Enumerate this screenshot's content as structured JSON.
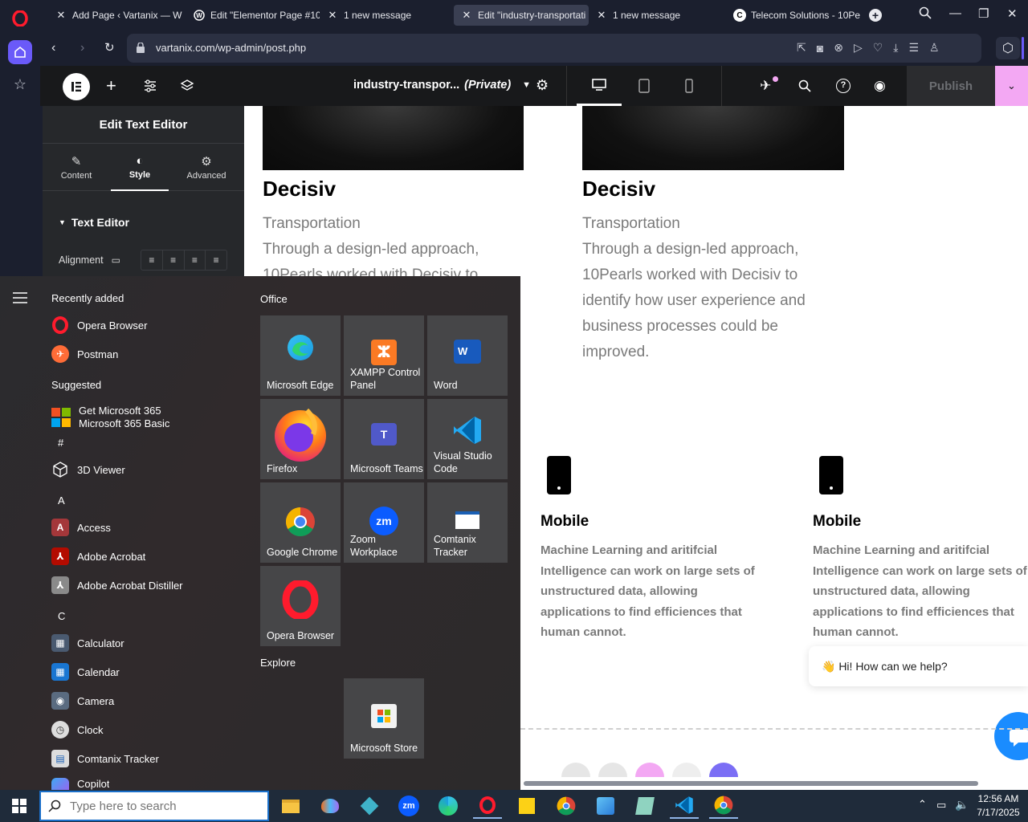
{
  "browser": {
    "tabs": [
      {
        "title": "Add Page ‹ Vartanix — W",
        "icon": "wordpress-icon"
      },
      {
        "title": "Edit \"Elementor Page #10",
        "icon": "elementor-icon"
      },
      {
        "title": "1 new message",
        "icon": "elementor-icon"
      },
      {
        "title": "Edit \"industry-transportati",
        "icon": "elementor-icon",
        "active": true
      },
      {
        "title": "1 new message",
        "icon": "elementor-icon"
      },
      {
        "title": "Telecom Solutions - 10Pe",
        "icon": "telecom-icon"
      }
    ],
    "url": "vartanix.com/wp-admin/post.php"
  },
  "elementor": {
    "page_title": "industry-transpor...",
    "page_status": "(Private)",
    "publish_label": "Publish",
    "panel_title": "Edit Text Editor",
    "panel_tabs": [
      "Content",
      "Style",
      "Advanced"
    ],
    "section_label": "Text Editor",
    "alignment_label": "Alignment"
  },
  "canvas": {
    "cards": [
      {
        "title": "Decisiv",
        "subtitle": "Transportation",
        "lines": [
          "Through a design-led approach,",
          "10Pearls worked with Decisiv to"
        ]
      },
      {
        "title": "Decisiv",
        "subtitle": "Transportation",
        "lines": [
          "Through a design-led approach,",
          "10Pearls worked with Decisiv to",
          "identify how user experience and",
          "business processes could be",
          "improved."
        ]
      }
    ],
    "mobile_cards": [
      {
        "title": "Mobile",
        "lines": [
          "Machine Learning and aritifcial",
          "Intelligence can work on large sets of",
          "unstructured data, allowing",
          "applications to find efficiences that",
          "human cannot."
        ]
      },
      {
        "title": "Mobile",
        "lines": [
          "Machine Learning and aritifcial",
          "Intelligence can work on large sets of",
          "unstructured data, allowing",
          "applications to find efficiences that",
          "human cannot."
        ]
      }
    ],
    "chat_bubble": "👋 Hi! How can we help?"
  },
  "start_menu": {
    "recently_added_label": "Recently added",
    "recent": [
      "Opera Browser",
      "Postman"
    ],
    "suggested_label": "Suggested",
    "suggested_title": "Get Microsoft 365",
    "suggested_sub": "Microsoft 365 Basic",
    "letters": [
      "#",
      "A",
      "C"
    ],
    "apps_hash": [
      "3D Viewer"
    ],
    "apps_a": [
      "Access",
      "Adobe Acrobat",
      "Adobe Acrobat Distiller"
    ],
    "apps_c": [
      "Calculator",
      "Calendar",
      "Camera",
      "Clock",
      "Comtanix Tracker",
      "Copilot"
    ],
    "office_label": "Office",
    "explore_label": "Explore",
    "tiles": [
      {
        "label": "Microsoft Edge"
      },
      {
        "label": "XAMPP Control Panel"
      },
      {
        "label": "Word"
      },
      {
        "label": "Firefox"
      },
      {
        "label": "Microsoft Teams"
      },
      {
        "label": "Visual Studio Code"
      },
      {
        "label": "Google Chrome"
      },
      {
        "label": "Zoom Workplace"
      },
      {
        "label": "Comtanix Tracker"
      },
      {
        "label": "Opera Browser"
      }
    ],
    "explore_tile": "Microsoft Store"
  },
  "taskbar": {
    "search_placeholder": "Type here to search",
    "time": "12:56 AM",
    "date": "7/17/2025"
  },
  "colors": {
    "accent": "#6a5af9",
    "publish_pink": "#f3a8f3",
    "opera_red": "#ff1b2d"
  }
}
